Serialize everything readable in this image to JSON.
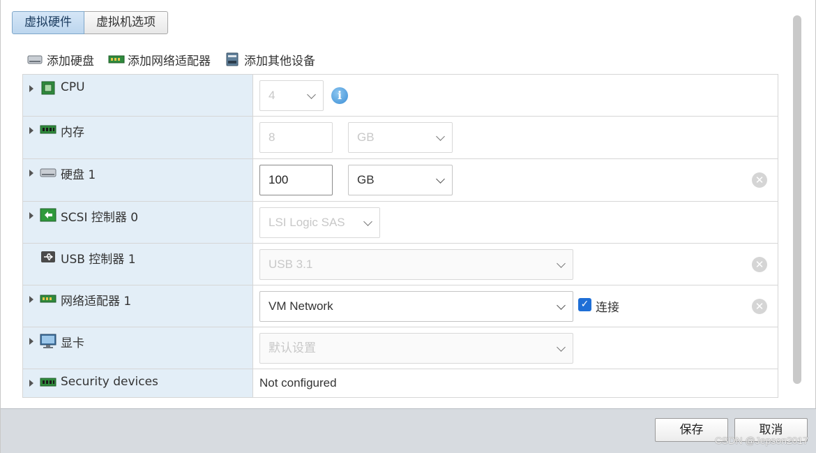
{
  "tabs": [
    {
      "label": "虚拟硬件",
      "active": true
    },
    {
      "label": "虚拟机选项",
      "active": false
    }
  ],
  "toolbar": {
    "add_disk": "添加硬盘",
    "add_network": "添加网络适配器",
    "add_other": "添加其他设备"
  },
  "rows": {
    "cpu": {
      "label": "CPU",
      "value": "4"
    },
    "memory": {
      "label": "内存",
      "value": "8",
      "unit": "GB"
    },
    "disk": {
      "label": "硬盘 1",
      "value": "100",
      "unit": "GB"
    },
    "scsi": {
      "label": "SCSI 控制器 0",
      "value": "LSI Logic SAS"
    },
    "usb": {
      "label": "USB 控制器 1",
      "value": "USB 3.1"
    },
    "network": {
      "label": "网络适配器 1",
      "value": "VM Network",
      "connect_label": "连接",
      "connected": true
    },
    "video": {
      "label": "显卡",
      "value": "默认设置"
    },
    "security": {
      "label": "Security devices",
      "value": "Not configured"
    }
  },
  "footer": {
    "save": "保存",
    "cancel": "取消",
    "watermark": "CSDN @Jepson2017"
  },
  "colors": {
    "label_bg": "#e3eef7",
    "active_tab": "#bcd6ee",
    "checkbox": "#1f6fd6",
    "footer_bg": "#d7dbe0"
  }
}
